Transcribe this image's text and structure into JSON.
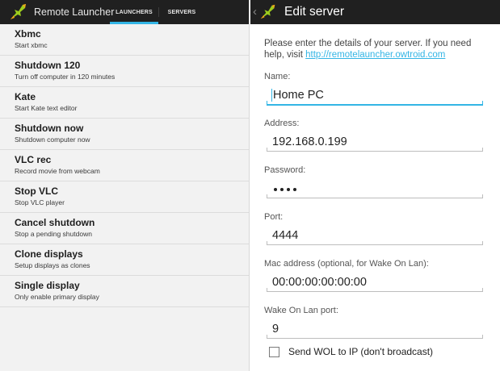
{
  "left": {
    "app_title": "Remote Launcher",
    "tabs": [
      {
        "label": "LAUNCHERS",
        "active": true
      },
      {
        "label": "SERVERS",
        "active": false
      }
    ],
    "launchers": [
      {
        "title": "Xbmc",
        "subtitle": "Start xbmc"
      },
      {
        "title": "Shutdown 120",
        "subtitle": "Turn off computer in 120 minutes"
      },
      {
        "title": "Kate",
        "subtitle": "Start Kate text editor"
      },
      {
        "title": "Shutdown now",
        "subtitle": "Shutdown computer now"
      },
      {
        "title": "VLC rec",
        "subtitle": "Record movie from webcam"
      },
      {
        "title": "Stop VLC",
        "subtitle": "Stop VLC player"
      },
      {
        "title": "Cancel shutdown",
        "subtitle": "Stop a pending shutdown"
      },
      {
        "title": "Clone displays",
        "subtitle": "Setup displays as clones"
      },
      {
        "title": "Single display",
        "subtitle": "Only enable primary display"
      }
    ]
  },
  "right": {
    "title": "Edit server",
    "intro": "Please enter the details of your server. If you need help, visit ",
    "help_link": "http://remotelauncher.owtroid.com",
    "fields": {
      "name": {
        "label": "Name:",
        "value": "Home PC"
      },
      "address": {
        "label": "Address:",
        "value": "192.168.0.199"
      },
      "password": {
        "label": "Password:",
        "masked_length": 4
      },
      "port": {
        "label": "Port:",
        "value": "4444"
      },
      "mac": {
        "label": "Mac address (optional, for Wake On Lan):",
        "value": "00:00:00:00:00:00"
      },
      "wol_port": {
        "label": "Wake On Lan port:",
        "value": "9"
      }
    },
    "wol_checkbox": {
      "label": "Send WOL to IP (don't broadcast)",
      "checked": false
    }
  },
  "colors": {
    "accent": "#33b5e5",
    "actionbar": "#202020",
    "logo_green": "#9ccc1c"
  }
}
